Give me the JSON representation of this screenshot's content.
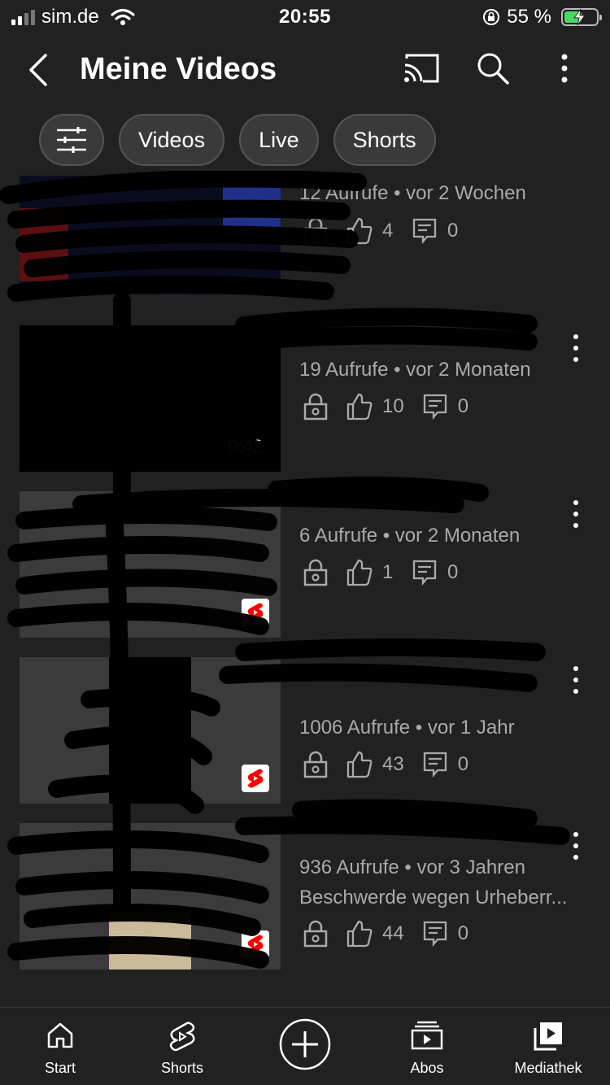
{
  "status_bar": {
    "carrier": "sim.de",
    "time": "20:55",
    "battery_percent": "55 %",
    "battery_level": 0.55
  },
  "header": {
    "title": "Meine Videos",
    "icons": [
      "back-arrow-icon",
      "cast-icon",
      "search-icon",
      "more-vertical-icon"
    ]
  },
  "chips": [
    {
      "label": "",
      "icon": "filter-sliders-icon"
    },
    {
      "label": "Videos"
    },
    {
      "label": "Live"
    },
    {
      "label": "Shorts"
    }
  ],
  "videos": [
    {
      "title": "",
      "meta": "12 Aufrufe • vor 2 Wochen",
      "likes": "4",
      "comments": "0",
      "extra": ""
    },
    {
      "title": "",
      "meta": "19 Aufrufe • vor 2 Monaten",
      "likes": "10",
      "comments": "0",
      "extra": "",
      "duration": "0:42"
    },
    {
      "title": "",
      "meta": "6 Aufrufe • vor 2 Monaten",
      "likes": "1",
      "comments": "0",
      "extra": ""
    },
    {
      "title": "",
      "meta": "1006 Aufrufe • vor 1 Jahr",
      "likes": "43",
      "comments": "0",
      "extra": ""
    },
    {
      "title": "",
      "meta": "936 Aufrufe • vor 3 Jahren",
      "likes": "44",
      "comments": "0",
      "extra": "Beschwerde wegen Urheberr..."
    }
  ],
  "bottom_nav": [
    {
      "label": "Start",
      "icon": "home-icon"
    },
    {
      "label": "Shorts",
      "icon": "shorts-icon"
    },
    {
      "label": "",
      "icon": "create-plus-icon"
    },
    {
      "label": "Abos",
      "icon": "subscriptions-icon"
    },
    {
      "label": "Mediathek",
      "icon": "library-icon"
    }
  ],
  "colors": {
    "background": "#212121",
    "text_primary": "#ffffff",
    "text_secondary": "#aaaaaa",
    "chip_background": "#3a3a3a",
    "shorts_red": "#ff0000"
  }
}
